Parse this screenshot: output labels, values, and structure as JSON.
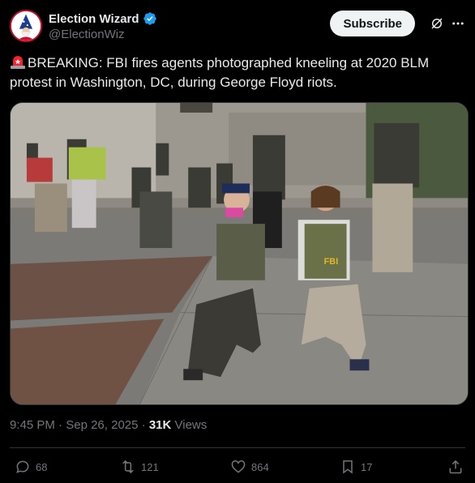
{
  "author": {
    "display_name": "Election Wizard",
    "handle": "@ElectionWiz",
    "avatar_icon": "wizard-avatar-icon",
    "verified_color": "#1d9bf0"
  },
  "header": {
    "subscribe_label": "Subscribe"
  },
  "tweet": {
    "text": "BREAKING: FBI fires agents photographed kneeling at 2020 BLM protest in Washington, DC, during George Floyd riots.",
    "media_icon": "photo-of-fbi-agents-kneeling"
  },
  "meta": {
    "time": "9:45 PM",
    "date": "Sep 26, 2025",
    "views_count": "31K",
    "views_label": "Views",
    "separator": "·"
  },
  "actions": {
    "replies": "68",
    "reposts": "121",
    "likes": "864",
    "bookmarks": "17"
  },
  "colors": {
    "background": "#000000",
    "text": "#e7e9ea",
    "muted": "#71767b",
    "accent": "#1d9bf0",
    "siren": "#f4212e"
  }
}
